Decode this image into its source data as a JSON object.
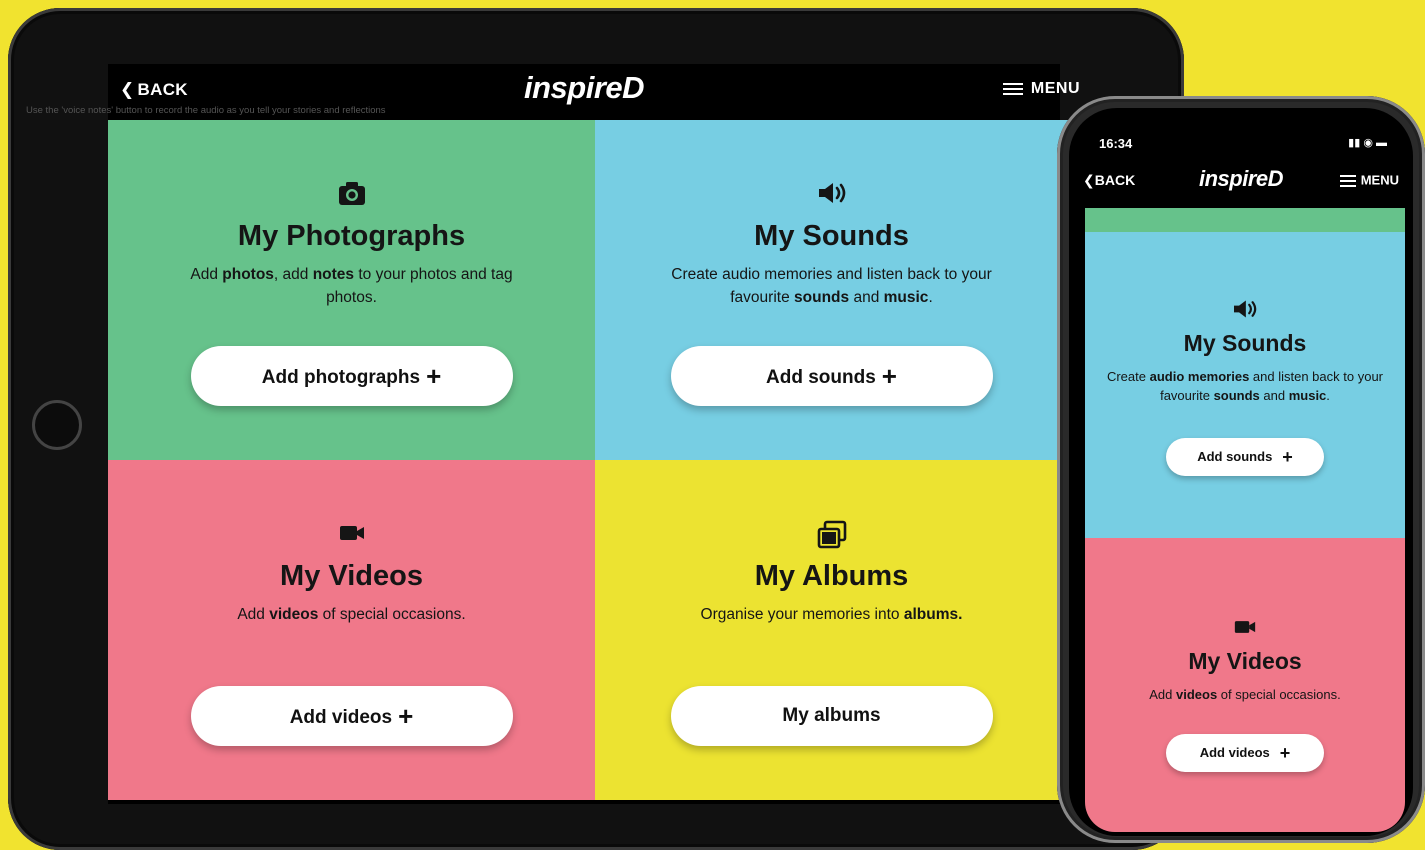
{
  "colors": {
    "background": "#f1e32f",
    "photos_tile": "#66c28b",
    "sounds_tile": "#77cee3",
    "videos_tile": "#f0788a",
    "albums_tile": "#ece331"
  },
  "tablet": {
    "header": {
      "back_label": "BACK",
      "logo": "inspireD",
      "menu_label": "MENU"
    },
    "hint": "Use the 'voice notes' button to record the audio as you tell your stories and reflections",
    "tiles": [
      {
        "icon": "camera-icon",
        "title": "My Photographs",
        "desc": [
          "Add ",
          "photos",
          ", add ",
          "notes",
          " to your photos and tag photos."
        ],
        "button": "Add photographs"
      },
      {
        "icon": "speaker-icon",
        "title": "My Sounds",
        "desc": [
          "Create audio memories and listen back to your favourite ",
          "sounds",
          " and ",
          "music",
          "."
        ],
        "button": "Add sounds"
      },
      {
        "icon": "video-camera-icon",
        "title": "My Videos",
        "desc": [
          "Add ",
          "videos",
          " of special occasions."
        ],
        "button": "Add videos"
      },
      {
        "icon": "albums-icon",
        "title": "My Albums",
        "desc": [
          "Organise your memories into ",
          "albums."
        ],
        "button": "My albums"
      }
    ]
  },
  "phone": {
    "status_time": "16:34",
    "header": {
      "back_label": "BACK",
      "logo": "inspireD",
      "menu_label": "MENU"
    },
    "tiles": [
      {
        "icon": "speaker-icon",
        "title": "My Sounds",
        "desc": [
          "Create ",
          "audio memories",
          " and listen back to your favourite ",
          "sounds",
          " and ",
          "music",
          "."
        ],
        "button": "Add sounds"
      },
      {
        "icon": "video-camera-icon",
        "title": "My Videos",
        "desc": [
          "Add ",
          "videos",
          " of special occasions."
        ],
        "button": "Add videos"
      }
    ]
  }
}
